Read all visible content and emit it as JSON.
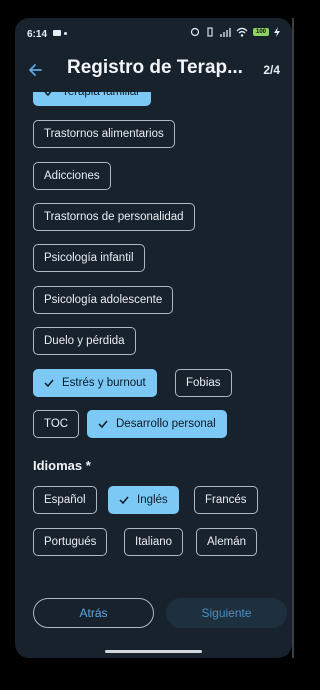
{
  "status_bar": {
    "time": "6:14",
    "battery": "100"
  },
  "header": {
    "title": "Registro de Terap...",
    "step": "2/4"
  },
  "specialties": [
    {
      "label": "Terapia familiar",
      "selected": true
    },
    {
      "label": "Trastornos alimentarios",
      "selected": false
    },
    {
      "label": "Adicciones",
      "selected": false
    },
    {
      "label": "Trastornos de personalidad",
      "selected": false
    },
    {
      "label": "Psicología infantil",
      "selected": false
    },
    {
      "label": "Psicología adolescente",
      "selected": false
    },
    {
      "label": "Duelo y pérdida",
      "selected": false
    },
    {
      "label": "Estrés y burnout",
      "selected": true
    },
    {
      "label": "Fobias",
      "selected": false
    },
    {
      "label": "TOC",
      "selected": false
    },
    {
      "label": "Desarrollo personal",
      "selected": true
    }
  ],
  "languages_section": {
    "label": "Idiomas *",
    "options": [
      {
        "label": "Español",
        "selected": false
      },
      {
        "label": "Inglés",
        "selected": true
      },
      {
        "label": "Francés",
        "selected": false
      },
      {
        "label": "Portugués",
        "selected": false
      },
      {
        "label": "Italiano",
        "selected": false
      },
      {
        "label": "Alemán",
        "selected": false
      }
    ]
  },
  "buttons": {
    "back_label": "Atrás",
    "next_label": "Siguiente"
  },
  "colors": {
    "background": "#18222d",
    "chip_selected": "#7cc9f5",
    "accent_text": "#5aa8e6",
    "header_back_arrow": "#5aa8e6"
  }
}
